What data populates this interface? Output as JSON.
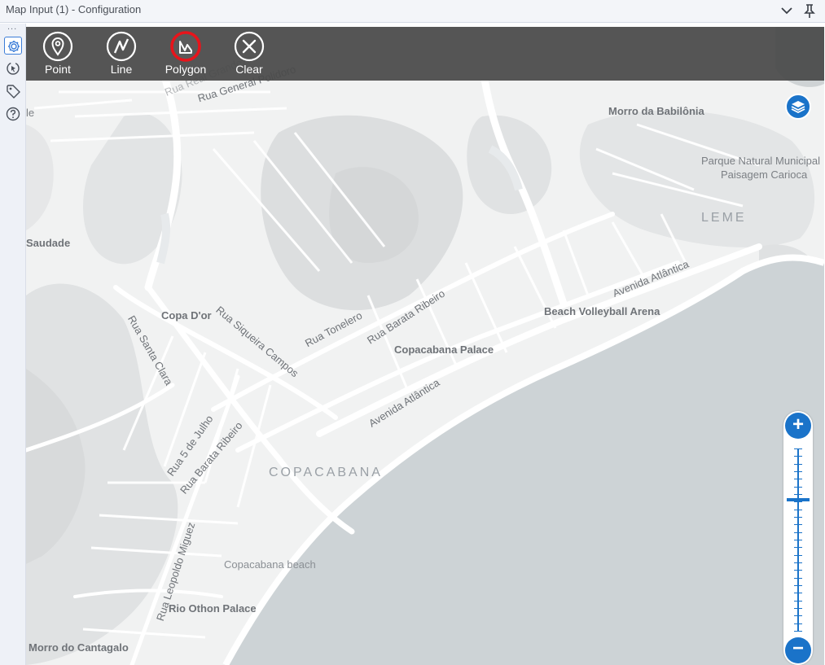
{
  "panel": {
    "title": "Map Input (1) - Configuration",
    "collapse_icon": "chevron-down-icon",
    "pin_icon": "pin-icon"
  },
  "rail": {
    "dots": "...",
    "buttons": [
      {
        "name": "settings",
        "icon": "gear-icon",
        "active": true
      },
      {
        "name": "connection",
        "icon": "cursor-circle-icon",
        "active": false
      },
      {
        "name": "annotation",
        "icon": "tag-icon",
        "active": false
      },
      {
        "name": "help",
        "icon": "help-icon",
        "active": false
      }
    ]
  },
  "toolbar": {
    "point": "Point",
    "line": "Line",
    "polygon": "Polygon",
    "clear": "Clear"
  },
  "map": {
    "labels": {
      "rua_general_polidoro": "Rua General Polidoro",
      "rua_real_grandeza": "Rua Real Grandeza",
      "morro_babilonia": "Morro da Babilônia",
      "parque_natural_1": "Parque Natural Municipal",
      "parque_natural_2": "Paisagem Carioca",
      "leme": "LEME",
      "saudade": "Saudade",
      "copa_dor": "Copa D'or",
      "rua_siqueira_campos": "Rua Siqueira Campos",
      "rua_tonelero": "Rua Tonelero",
      "rua_barata_ribeiro_1": "Rua Barata Ribeiro",
      "avenida_atlantica_1": "Avenida Atlântica",
      "beach_volleyball": "Beach Volleyball Arena",
      "copacabana_palace": "Copacabana Palace",
      "rua_santa_clara": "Rua Santa Clara",
      "avenida_atlantica_2": "Avenida Atlântica",
      "rua_5_de_julho": "Rua 5 de Julho",
      "rua_barata_ribeiro_2": "Rua Barata Ribeiro",
      "copacabana": "COPACABANA",
      "copacabana_beach": "Copacabana beach",
      "rua_leopoldo_miguez": "Rua Leopoldo Miguez",
      "rio_othon_palace": "Rio Othon Palace",
      "morro_cantagalo": "Morro do Cantagalo",
      "partial_le": "le"
    },
    "zoom_in": "+",
    "zoom_out": "−",
    "zoom_level": 0.72
  },
  "colors": {
    "accent": "#1a73c9",
    "highlight_ring": "#e8141b",
    "toolbar_bg": "#4a4a4a",
    "water": "#cdd3d6",
    "land": "#f1f2f2",
    "hills": "#dcdedf"
  }
}
